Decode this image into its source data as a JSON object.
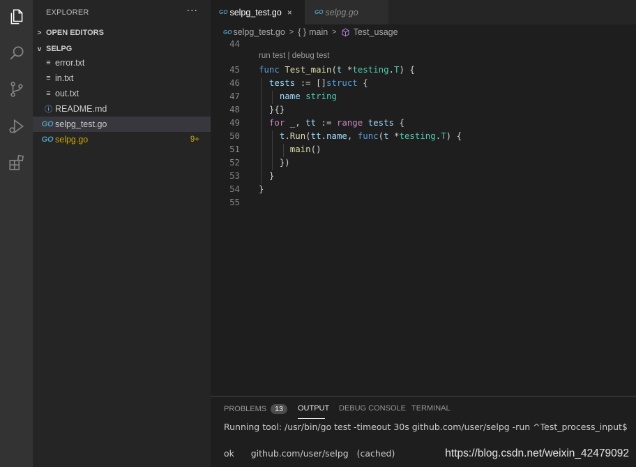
{
  "sidebar": {
    "title": "EXPLORER",
    "more": "···",
    "open_editors": "OPEN EDITORS",
    "folder": "SELPG",
    "files": [
      {
        "name": "error.txt",
        "icon": "lines-icon"
      },
      {
        "name": "in.txt",
        "icon": "lines-icon"
      },
      {
        "name": "out.txt",
        "icon": "lines-icon"
      },
      {
        "name": "README.md",
        "icon": "info-icon"
      },
      {
        "name": "selpg_test.go",
        "icon": "go-icon",
        "active": true
      },
      {
        "name": "selpg.go",
        "icon": "go-icon",
        "badge": "9+"
      }
    ]
  },
  "tabs": [
    {
      "label": "selpg_test.go",
      "active": true,
      "close": "×"
    },
    {
      "label": "selpg.go",
      "active": false
    }
  ],
  "go_glyph": "GO",
  "breadcrumb": {
    "file": "selpg_test.go",
    "braces": "{ }",
    "func": "main",
    "symbol": "Test_usage"
  },
  "editor": {
    "first_line": "44",
    "codelens": "run test | debug test",
    "line_numbers": [
      "45",
      "46",
      "47",
      "48",
      "49",
      "50",
      "51",
      "52",
      "53",
      "54",
      "55"
    ]
  },
  "panel": {
    "tabs": [
      "PROBLEMS",
      "OUTPUT",
      "DEBUG CONSOLE",
      "TERMINAL"
    ],
    "problems_count": "13",
    "lines": [
      "Running tool: /usr/bin/go test -timeout 30s github.com/user/selpg -run ^Test_process_input$",
      "ok      github.com/user/selpg   (cached)"
    ]
  },
  "watermark": "https://blog.csdn.net/weixin_42479092",
  "colors": {
    "activity_bar": "#333333",
    "sidebar": "#252526",
    "editor": "#1e1e1e",
    "modified_badge": "#cca700",
    "go_icon": "#519aba"
  }
}
